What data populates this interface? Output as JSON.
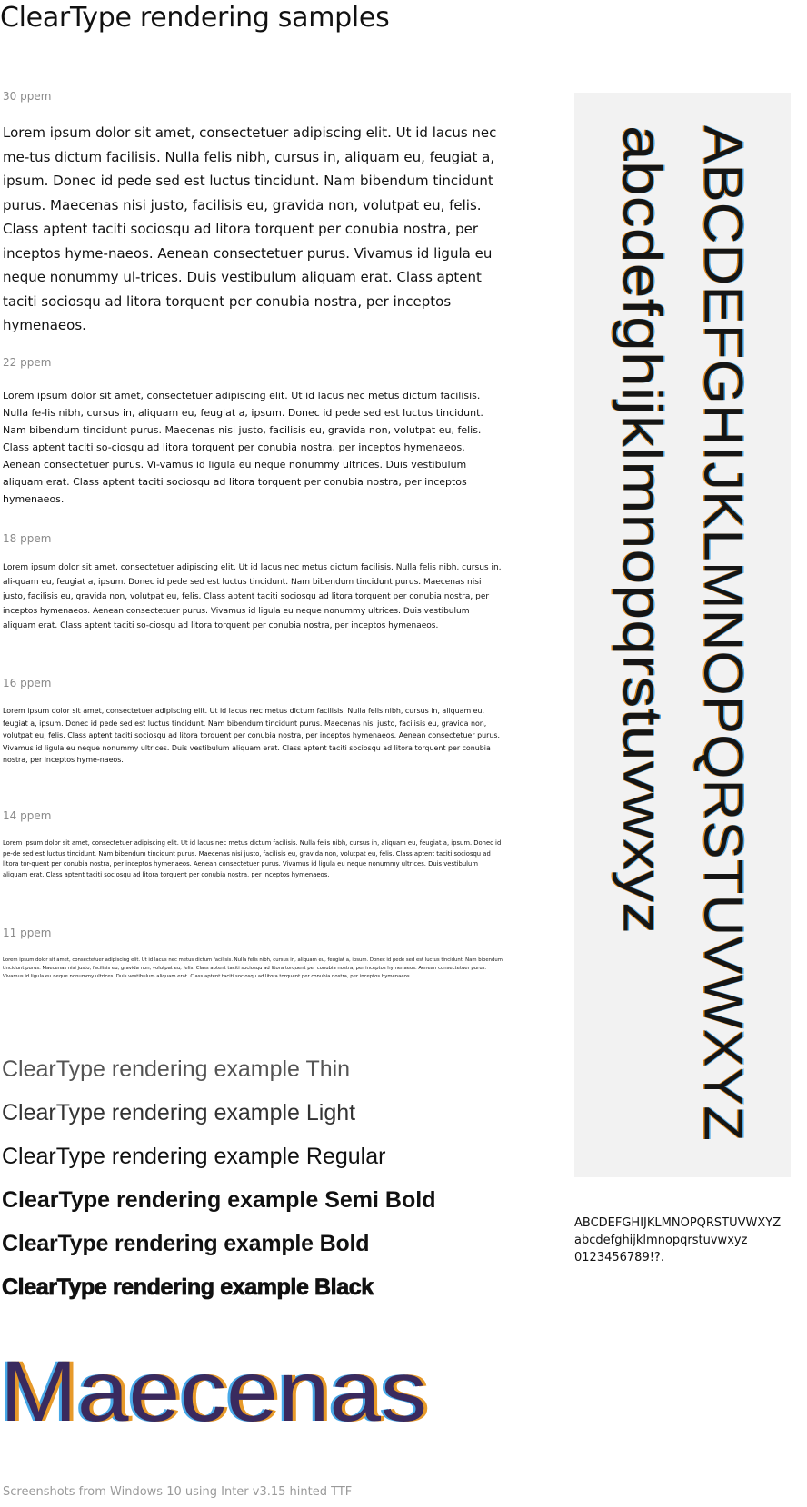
{
  "page": {
    "title": "ClearType rendering samples",
    "footer": "Screenshots from Windows 10 using Inter v3.15 hinted TTF"
  },
  "samples": [
    {
      "label": "30 ppem",
      "text": "Lorem ipsum dolor sit amet, consectetuer adipiscing elit. Ut id lacus nec me-tus dictum facilisis. Nulla felis nibh, cursus in, aliquam eu, feugiat a, ipsum. Donec id pede sed est luctus tincidunt. Nam bibendum tincidunt purus. Maecenas nisi justo, facilisis eu, gravida non, volutpat eu, felis. Class aptent taciti sociosqu ad litora torquent per conubia nostra, per inceptos hyme-naeos. Aenean consectetuer purus. Vivamus id ligula eu neque nonummy ul-trices. Duis vestibulum aliquam erat. Class aptent taciti sociosqu ad litora torquent per conubia nostra, per inceptos hymenaeos."
    },
    {
      "label": "22 ppem",
      "text": "Lorem ipsum dolor sit amet, consectetuer adipiscing elit. Ut id lacus nec metus dictum facilisis. Nulla fe-lis nibh, cursus in, aliquam eu, feugiat a, ipsum. Donec id pede sed est luctus tincidunt. Nam bibendum tincidunt purus. Maecenas nisi justo, facilisis eu, gravida non, volutpat eu, felis. Class aptent taciti so-ciosqu ad litora torquent per conubia nostra, per inceptos hymenaeos. Aenean consectetuer purus. Vi-vamus id ligula eu neque nonummy ultrices. Duis vestibulum aliquam erat. Class aptent taciti sociosqu ad litora torquent per conubia nostra, per inceptos hymenaeos."
    },
    {
      "label": "18 ppem",
      "text": "Lorem ipsum dolor sit amet, consectetuer adipiscing elit. Ut id lacus nec metus dictum facilisis. Nulla felis nibh, cursus in, ali-quam eu, feugiat a, ipsum. Donec id pede sed est luctus tincidunt. Nam bibendum tincidunt purus. Maecenas nisi justo, facilisis eu, gravida non, volutpat eu, felis. Class aptent taciti sociosqu ad litora torquent per conubia nostra, per inceptos hymenaeos. Aenean consectetuer purus. Vivamus id ligula eu neque nonummy ultrices. Duis vestibulum aliquam erat. Class aptent taciti so-ciosqu ad litora torquent per conubia nostra, per inceptos hymenaeos."
    },
    {
      "label": "16 ppem",
      "text": "Lorem ipsum dolor sit amet, consectetuer adipiscing elit. Ut id lacus nec metus dictum facilisis. Nulla felis nibh, cursus in, aliquam eu, feugiat a, ipsum. Donec id pede sed est luctus tincidunt. Nam bibendum tincidunt purus. Maecenas nisi justo, facilisis eu, gravida non, volutpat eu, felis. Class aptent taciti sociosqu ad litora torquent per conubia nostra, per inceptos hymenaeos. Aenean consectetuer purus. Vivamus id ligula eu neque nonummy ultrices. Duis vestibulum aliquam erat. Class aptent taciti sociosqu ad litora torquent per conubia nostra, per inceptos hyme-naeos."
    },
    {
      "label": "14 ppem",
      "text": "Lorem ipsum dolor sit amet, consectetuer adipiscing elit. Ut id lacus nec metus dictum facilisis. Nulla felis nibh, cursus in, aliquam eu, feugiat a, ipsum. Donec id pe-de sed est luctus tincidunt. Nam bibendum tincidunt purus. Maecenas nisi justo, facilisis eu, gravida non, volutpat eu, felis. Class aptent taciti sociosqu ad litora tor-quent per conubia nostra, per inceptos hymenaeos. Aenean consectetuer purus. Vivamus id ligula eu neque nonummy ultrices. Duis vestibulum aliquam erat. Class aptent taciti sociosqu ad litora torquent per conubia nostra, per inceptos hymenaeos."
    },
    {
      "label": "11 ppem",
      "text": "Lorem ipsum dolor sit amet, consectetuer adipiscing elit. Ut id lacus nec metus dictum facilisis. Nulla felis nibh, cursus in, aliquam eu, feugiat a, ipsum. Donec id pede sed est luctus tincidunt. Nam bibendum tincidunt purus. Maecenas nisi justo, facilisis eu, gravida non, volutpat eu, felis. Class aptent taciti sociosqu ad litora torquent per conubia nostra, per inceptos hymenaeos. Aenean consectetuer purus. Vivamus id ligula eu neque nonummy ultrices. Duis vestibulum aliquam erat. Class aptent taciti sociosqu ad litora torquent per conubia nostra, per inceptos hymenaeos."
    }
  ],
  "weights": [
    "ClearType rendering example Thin",
    "ClearType rendering example Light",
    "ClearType rendering example Regular",
    "ClearType rendering example Semi Bold",
    "ClearType rendering example Bold",
    "ClearType rendering example Black"
  ],
  "pixel_word": "Maecenas",
  "specimen": {
    "uppercase": "ABCDEFGHIJKLMNOPQRSTUVWXYZ",
    "lowercase": "abcdefghijklmnopqrstuvwxyz"
  },
  "charset": {
    "uppercase": "ABCDEFGHIJKLMNOPQRSTUVWXYZ",
    "lowercase": "abcdefghijklmnopqrstuvwxyz",
    "digits": "0123456789!?."
  },
  "colors": {
    "label_gray": "#8a8a8a",
    "panel_bg": "#f2f2f2",
    "text": "#111111",
    "fringe_blue": "#3a8fd8",
    "fringe_orange": "#e08a1e"
  }
}
